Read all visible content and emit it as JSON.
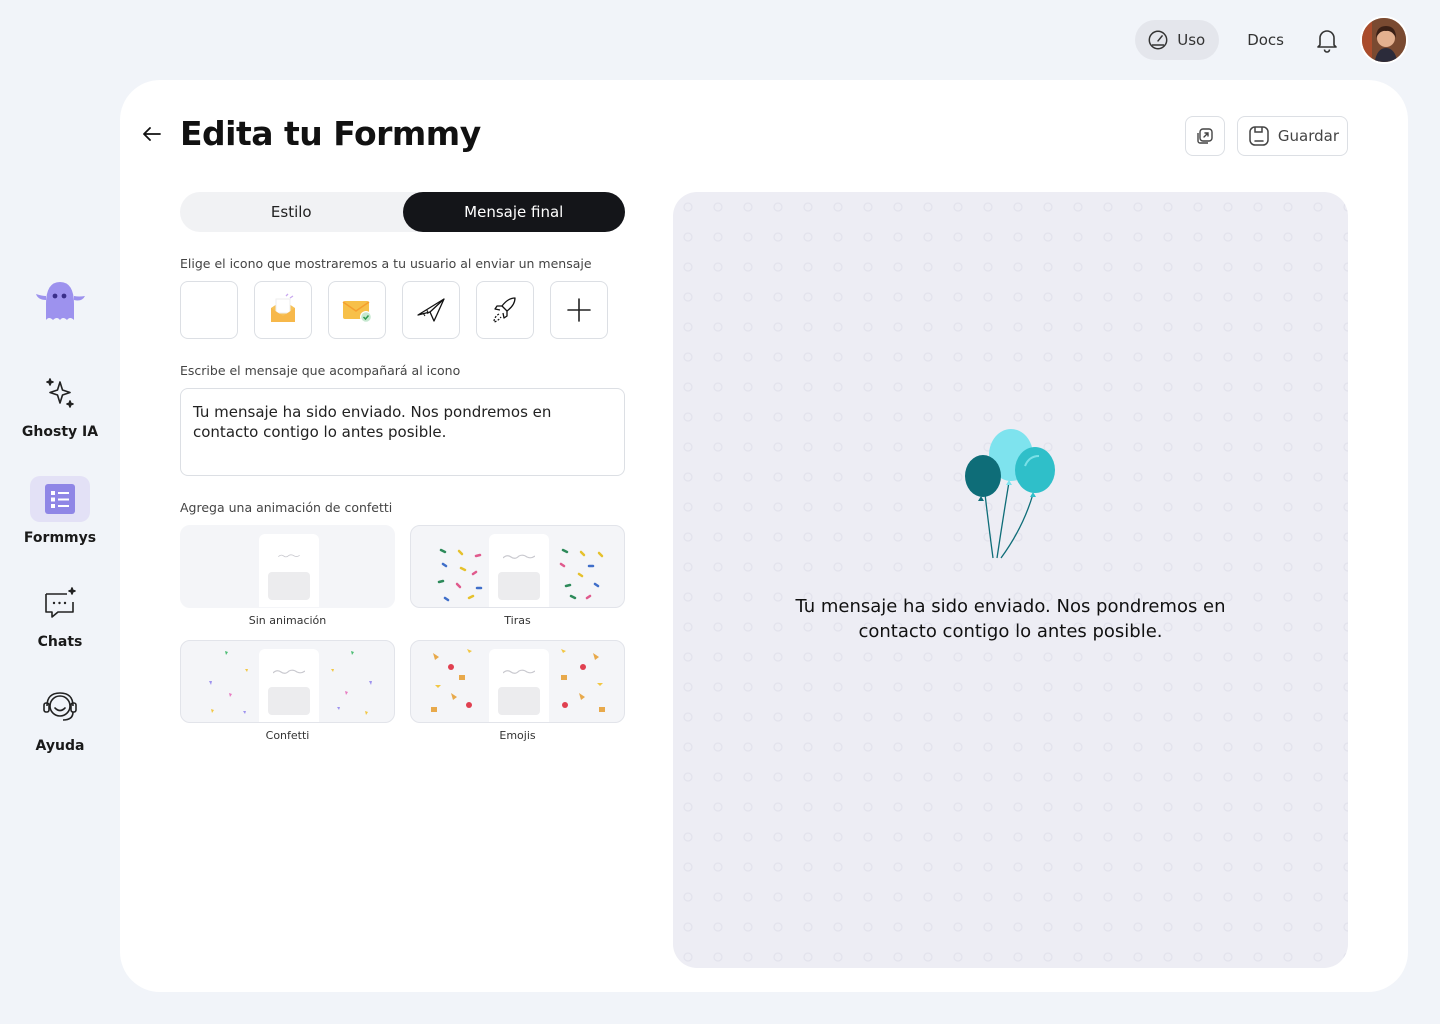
{
  "topbar": {
    "uso_label": "Uso",
    "docs_label": "Docs"
  },
  "sidebar": {
    "items": [
      {
        "label": "Ghosty IA"
      },
      {
        "label": "Formmys"
      },
      {
        "label": "Chats"
      },
      {
        "label": "Ayuda"
      }
    ]
  },
  "header": {
    "title": "Edita tu Formmy",
    "save_label": "Guardar"
  },
  "tabs": [
    {
      "label": "Estilo"
    },
    {
      "label": "Mensaje final"
    }
  ],
  "icon_section": {
    "label": "Elige el icono que mostraremos a tu usuario al enviar un mensaje"
  },
  "message_section": {
    "label": "Escribe el mensaje que acompañará al icono",
    "value": "Tu mensaje ha sido enviado. Nos pondremos en contacto contigo lo antes posible."
  },
  "confetti_section": {
    "label": "Agrega una animación de confetti",
    "options": [
      {
        "label": "Sin animación"
      },
      {
        "label": "Tiras"
      },
      {
        "label": "Confetti"
      },
      {
        "label": "Emojis"
      }
    ]
  },
  "preview": {
    "message": "Tu mensaje ha sido enviado. Nos pondremos en contacto contigo lo antes posible."
  },
  "colors": {
    "accent": "#8f86e6",
    "dark": "#141519",
    "balloon_dark": "#0e6d78",
    "balloon_light": "#7ee3ee",
    "balloon_mid": "#2fbfc9"
  }
}
